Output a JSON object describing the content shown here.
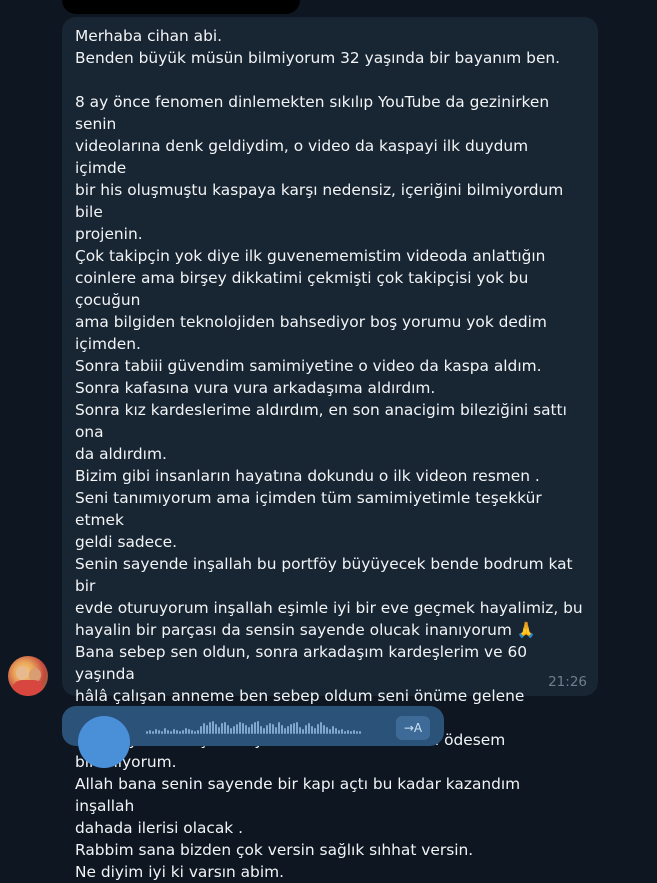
{
  "message": {
    "text": "Merhaba cihan abi.\nBenden büyük müsün bilmiyorum 32 yaşında bir bayanım ben.\n\n8 ay önce fenomen dinlemekten sıkılıp YouTube da gezinirken senin\nvideolarına denk geldiydim, o video da kaspayi ilk duydum içimde\nbir his oluşmuştu kaspaya karşı nedensiz, içeriğini bilmiyordum bile\nprojenin.\nÇok takipçin yok diye ilk guvenememistim videoda anlattığın\ncoinlere ama birşey dikkatimi çekmişti çok takipçisi yok bu çocuğun\nama bilgiden teknolojiden bahsediyor boş yorumu yok dedim\niçimden.\nSonra tabiii güvendim samimiyetine o video da kaspa aldım.\nSonra kafasına vura vura arkadaşıma aldırdım.\nSonra kız kardeslerime aldırdım, en son anacigim bileziğini sattı ona\nda aldırdım.\nBizim gibi insanların hayatına dokundu o ilk videon resmen .\nSeni tanımıyorum ama içimden tüm samimiyetimle teşekkür etmek\ngeldi sadece.\nSenin sayende inşallah bu portföy büyüyecek bende bodrum kat bir\nevde oturuyorum inşallah eşimle iyi bir eve geçmek hayalimiz, bu\nhayalin bir parçası da sensin sayende olucak inanıyorum 🙏\nBana sebep sen oldun, sonra arkadaşım kardeşlerim ve 60 yaşında\nhâlâ çalışan anneme ben sebep oldum seni önüme gelene\nanlatıyorum bahsediyorum.\nNe bileyim ki başka ne yazsam da sana hakkını ödesem\nbilemiyorum.\nAllah bana senin sayende bir kapı açtı bu kadar kazandım inşallah\ndahada ilerisi olacak .\nRabbim sana bizden çok versin sağlık sıhhat versin.\nNe diyim iyi ki varsın abim.",
    "time": "21:26"
  },
  "voice_message": {
    "transcribe_label": "→A"
  },
  "colors": {
    "background": "#0e1621",
    "incoming_bubble": "#182533",
    "outgoing_bubble": "#2b5278",
    "time_text": "#6d7f8f"
  },
  "icons": {
    "media_stop": "stop-icon",
    "media_record": "record-icon",
    "media_back": "back-icon",
    "voice_play": "play-icon",
    "transcribe": "transcribe-icon"
  }
}
